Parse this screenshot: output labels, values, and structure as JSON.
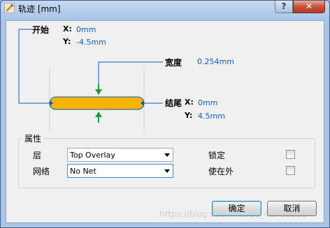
{
  "window": {
    "title": "轨迹 [mm]",
    "help_glyph": "?",
    "close_glyph": "✕"
  },
  "graphic": {
    "start_label": "开始",
    "start_x_label": "X:",
    "start_x_value": "0mm",
    "start_y_label": "Y:",
    "start_y_value": "-4.5mm",
    "width_label": "宽度",
    "width_value": "0.254mm",
    "end_label": "结尾",
    "end_x_label": "X:",
    "end_x_value": "0mm",
    "end_y_label": "Y:",
    "end_y_value": "4.5mm",
    "track_color": "#f5b400",
    "arrow_color": "#1a9a4a",
    "line_color": "#0a57b8"
  },
  "properties": {
    "group_title": "属性",
    "layer_label": "层",
    "layer_value": "Top Overlay",
    "net_label": "网络",
    "net_value": "No Net",
    "locked_label": "锁定",
    "locked_checked": false,
    "keepout_label": "使在外",
    "keepout_checked": false
  },
  "buttons": {
    "ok": "确定",
    "cancel": "取消"
  },
  "watermark": "https://blog.csdn.net/qq_41762681"
}
